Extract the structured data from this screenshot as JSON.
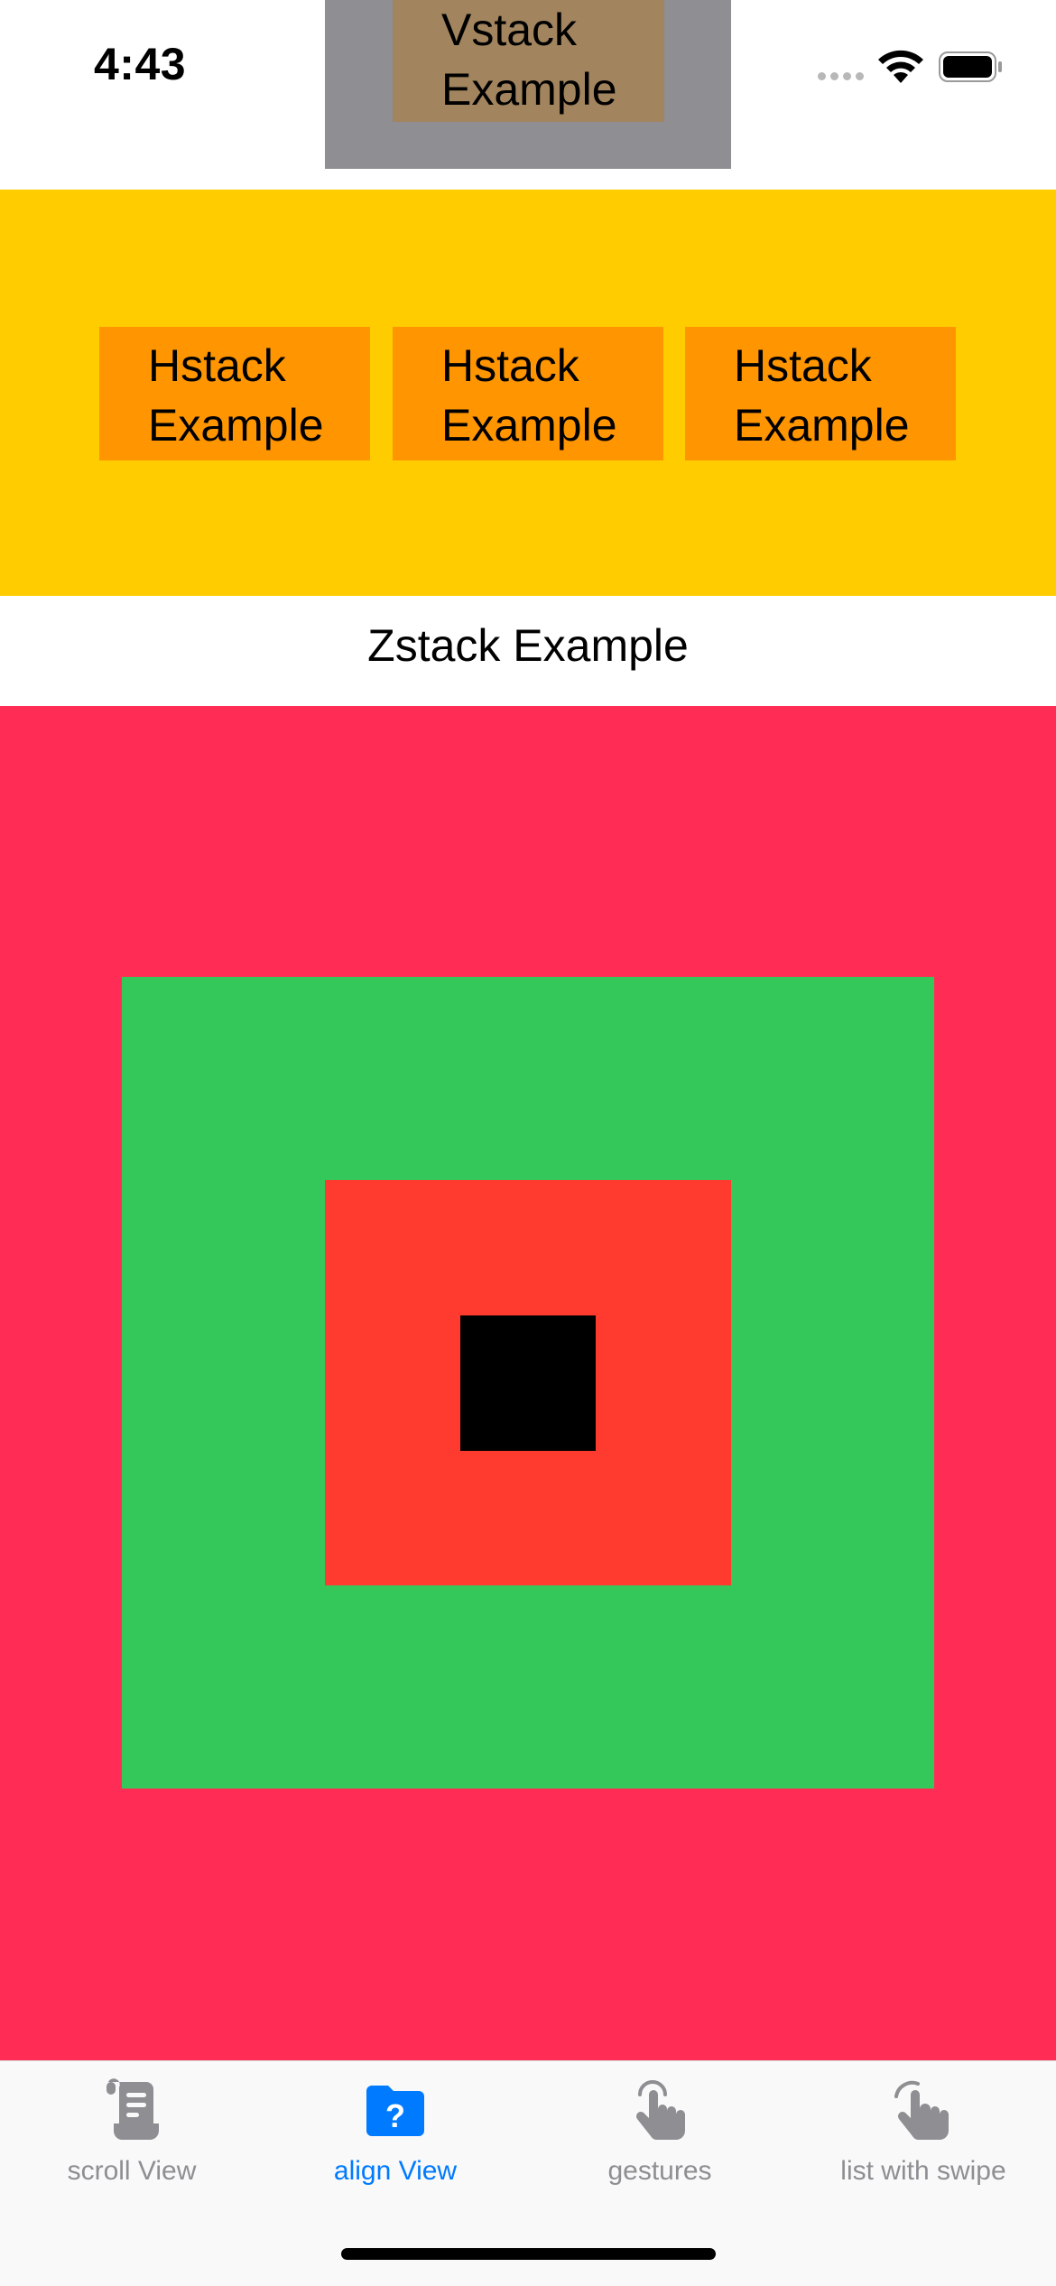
{
  "status_bar": {
    "time": "4:43"
  },
  "vstack": {
    "text": "Vstack Example"
  },
  "hstack": {
    "cards": [
      "Hstack Example",
      "Hstack Example",
      "Hstack Example"
    ]
  },
  "zstack": {
    "label": "Zstack Example"
  },
  "tabs": [
    {
      "label": "scroll View",
      "icon": "scroll-icon",
      "active": false
    },
    {
      "label": "align View",
      "icon": "questionmark-folder-icon",
      "active": true
    },
    {
      "label": "gestures",
      "icon": "hand-tap-icon",
      "active": false
    },
    {
      "label": "list with swipe",
      "icon": "hand-swipe-icon",
      "active": false
    }
  ],
  "colors": {
    "accent": "#007aff",
    "inactive_tab": "#8e8e93",
    "hstack_band": "#ffcc00",
    "hstack_card": "#ff9500",
    "vstack_outer": "#8e8e93",
    "vstack_inner": "#a2845e",
    "zstack_pink": "#ff2d55",
    "zstack_green": "#34c759",
    "zstack_red": "#ff3b30",
    "zstack_black": "#000000"
  }
}
